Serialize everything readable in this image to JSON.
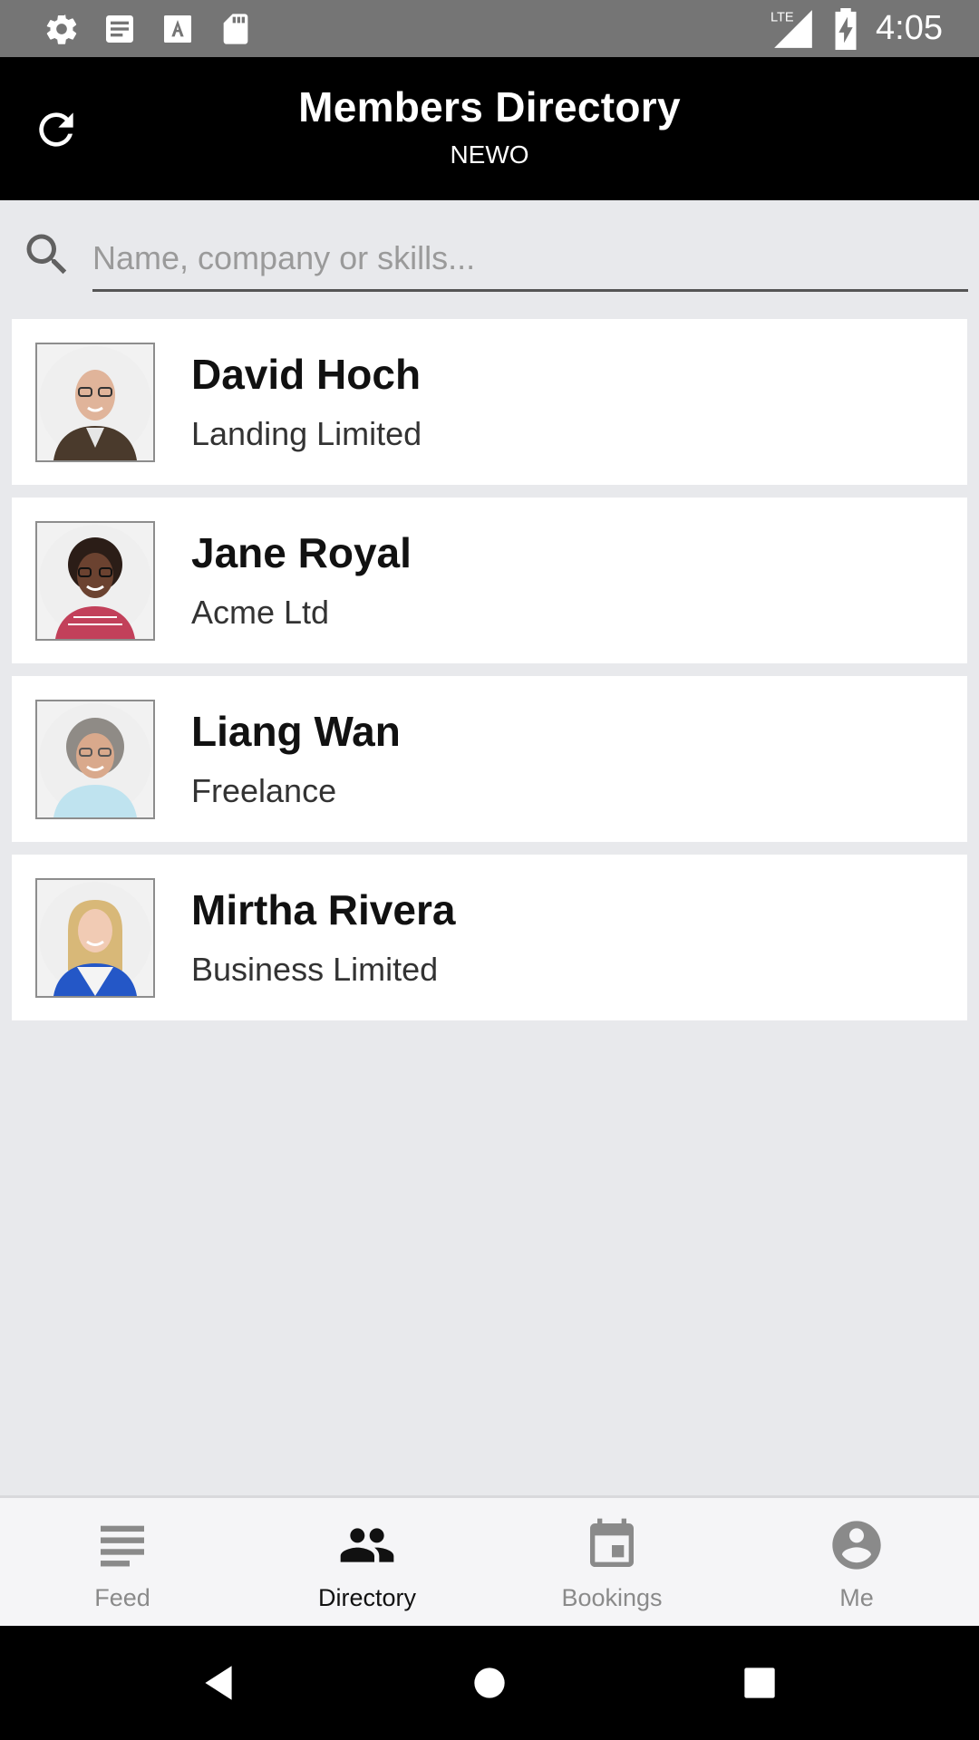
{
  "status_bar": {
    "time": "4:05",
    "network": "LTE",
    "icons": [
      "settings-icon",
      "news-icon",
      "font-icon",
      "sd-card-icon",
      "signal-icon",
      "battery-charging-icon"
    ]
  },
  "header": {
    "title": "Members Directory",
    "subtitle": "NEWO",
    "refresh_icon": "refresh-icon"
  },
  "search": {
    "placeholder": "Name, company or skills...",
    "value": ""
  },
  "members": [
    {
      "name": "David Hoch",
      "company": "Landing Limited"
    },
    {
      "name": "Jane Royal",
      "company": "Acme Ltd"
    },
    {
      "name": "Liang Wan",
      "company": "Freelance"
    },
    {
      "name": "Mirtha Rivera",
      "company": "Business Limited"
    }
  ],
  "bottom_nav": {
    "active": "Directory",
    "items": [
      {
        "label": "Feed",
        "icon": "feed-icon"
      },
      {
        "label": "Directory",
        "icon": "people-icon"
      },
      {
        "label": "Bookings",
        "icon": "calendar-icon"
      },
      {
        "label": "Me",
        "icon": "account-icon"
      }
    ]
  },
  "colors": {
    "header_bg": "#000000",
    "status_bar_bg": "#757575",
    "page_bg": "#e8e9ec",
    "nav_active": "#111111",
    "nav_inactive": "#8a8a8a"
  }
}
